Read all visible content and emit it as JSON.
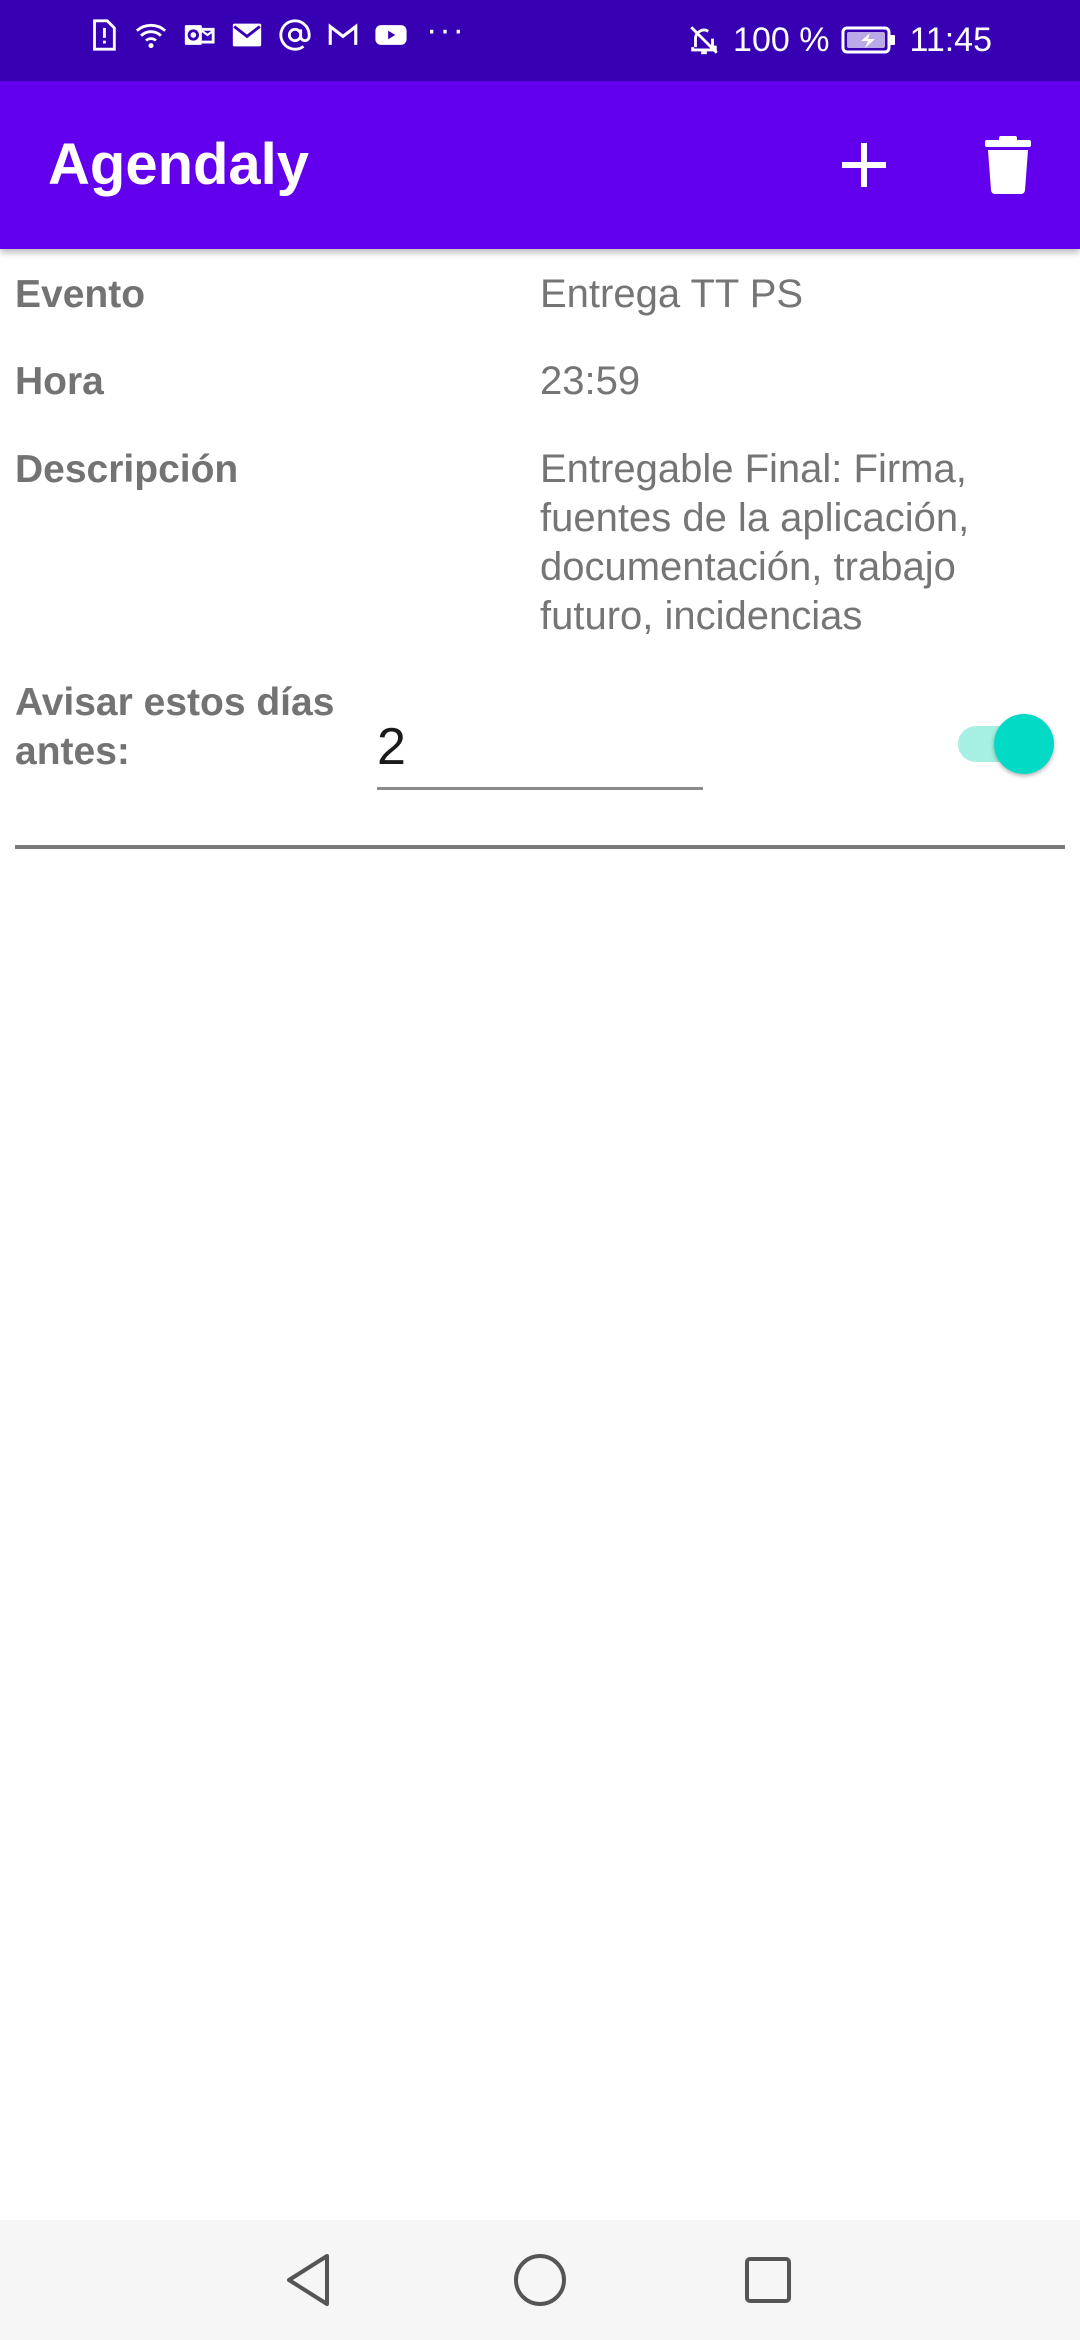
{
  "status_bar": {
    "battery": "100 %",
    "time": "11:45",
    "left_icons": [
      "sim-alert-icon",
      "wifi-icon",
      "outlook-icon",
      "mail-icon",
      "at-sign-icon",
      "gmail-icon",
      "youtube-icon",
      "more-notifications-icon"
    ],
    "more": "···"
  },
  "app_bar": {
    "title": "Agendaly",
    "actions": [
      "add-icon",
      "delete-icon"
    ]
  },
  "event": {
    "evento_label": "Evento",
    "evento_value": "Entrega TT PS",
    "hora_label": "Hora",
    "hora_value": "23:59",
    "descripcion_label": "Descripción",
    "descripcion_value": "Entregable Final: Firma, fuentes de la aplicación, documentación, trabajo futuro, incidencias",
    "avisar_label": "Avisar estos días antes:",
    "avisar_value": "2",
    "reminder_enabled": true
  },
  "nav_bar": {
    "buttons": [
      "back-icon",
      "home-icon",
      "recents-icon"
    ]
  },
  "colors": {
    "status_bar": "#3700b3",
    "app_bar": "#6200ee",
    "accent": "#03dac5",
    "label_text": "#737373",
    "value_text": "#757575"
  }
}
